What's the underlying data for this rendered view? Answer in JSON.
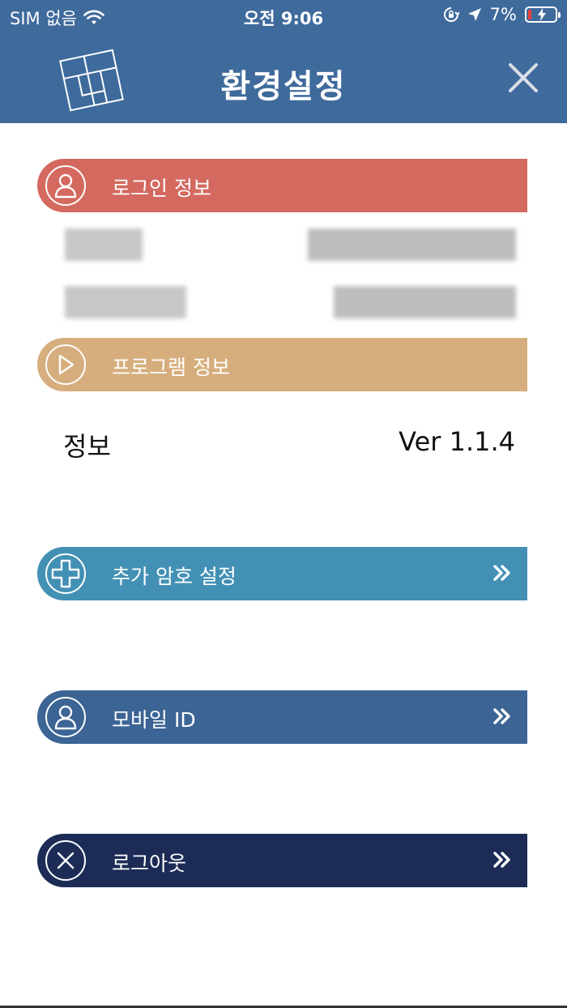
{
  "status_bar": {
    "carrier": "SIM 없음",
    "time": "오전 9:06",
    "battery": "7%"
  },
  "header": {
    "title": "환경설정"
  },
  "sections": {
    "login_info": {
      "label": "로그인 정보"
    },
    "program_info": {
      "label": "프로그램 정보"
    }
  },
  "program": {
    "info_label": "정보",
    "version": "Ver 1.1.4"
  },
  "menu": {
    "additional_password": "추가 암호 설정",
    "mobile_id": "모바일 ID",
    "logout": "로그아웃"
  },
  "colors": {
    "header": "#3f6a9c",
    "login": "#d4695f",
    "program": "#d6ae7d",
    "additional_password": "#4390b5",
    "mobile_id": "#3c6494",
    "logout": "#1c2c56"
  }
}
